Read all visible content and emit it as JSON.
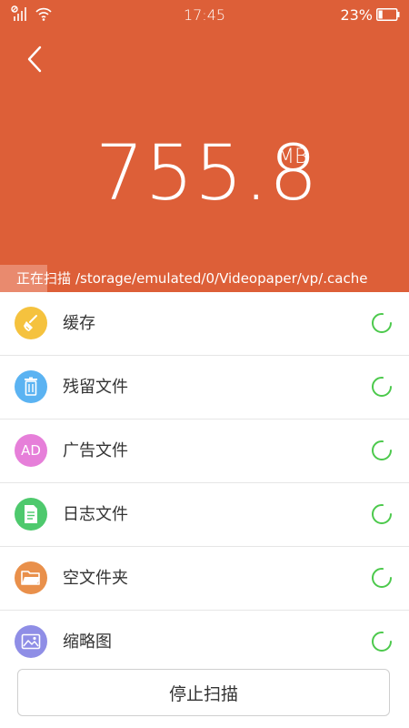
{
  "status_bar": {
    "time": "17:45",
    "battery_percent": "23%",
    "battery_level": 0.23
  },
  "header": {
    "size_value": "755.8",
    "size_unit": "MB",
    "scan_label": "正在扫描",
    "scan_path": "/storage/emulated/0/Videopaper/vp/.cache",
    "bg_color": "#DD5F38"
  },
  "categories": [
    {
      "label": "缓存",
      "icon": "broom-icon",
      "color": "#F5C23E"
    },
    {
      "label": "残留文件",
      "icon": "trash-icon",
      "color": "#5BB3F2"
    },
    {
      "label": "广告文件",
      "icon": "ad-icon",
      "icon_text": "AD",
      "color": "#E67FD9"
    },
    {
      "label": "日志文件",
      "icon": "document-icon",
      "color": "#4EC96D"
    },
    {
      "label": "空文件夹",
      "icon": "folder-icon",
      "color": "#E9904B"
    },
    {
      "label": "缩略图",
      "icon": "image-icon",
      "color": "#8F8EE6"
    }
  ],
  "spinner_color": "#4CC94C",
  "stop_button": {
    "label": "停止扫描"
  }
}
